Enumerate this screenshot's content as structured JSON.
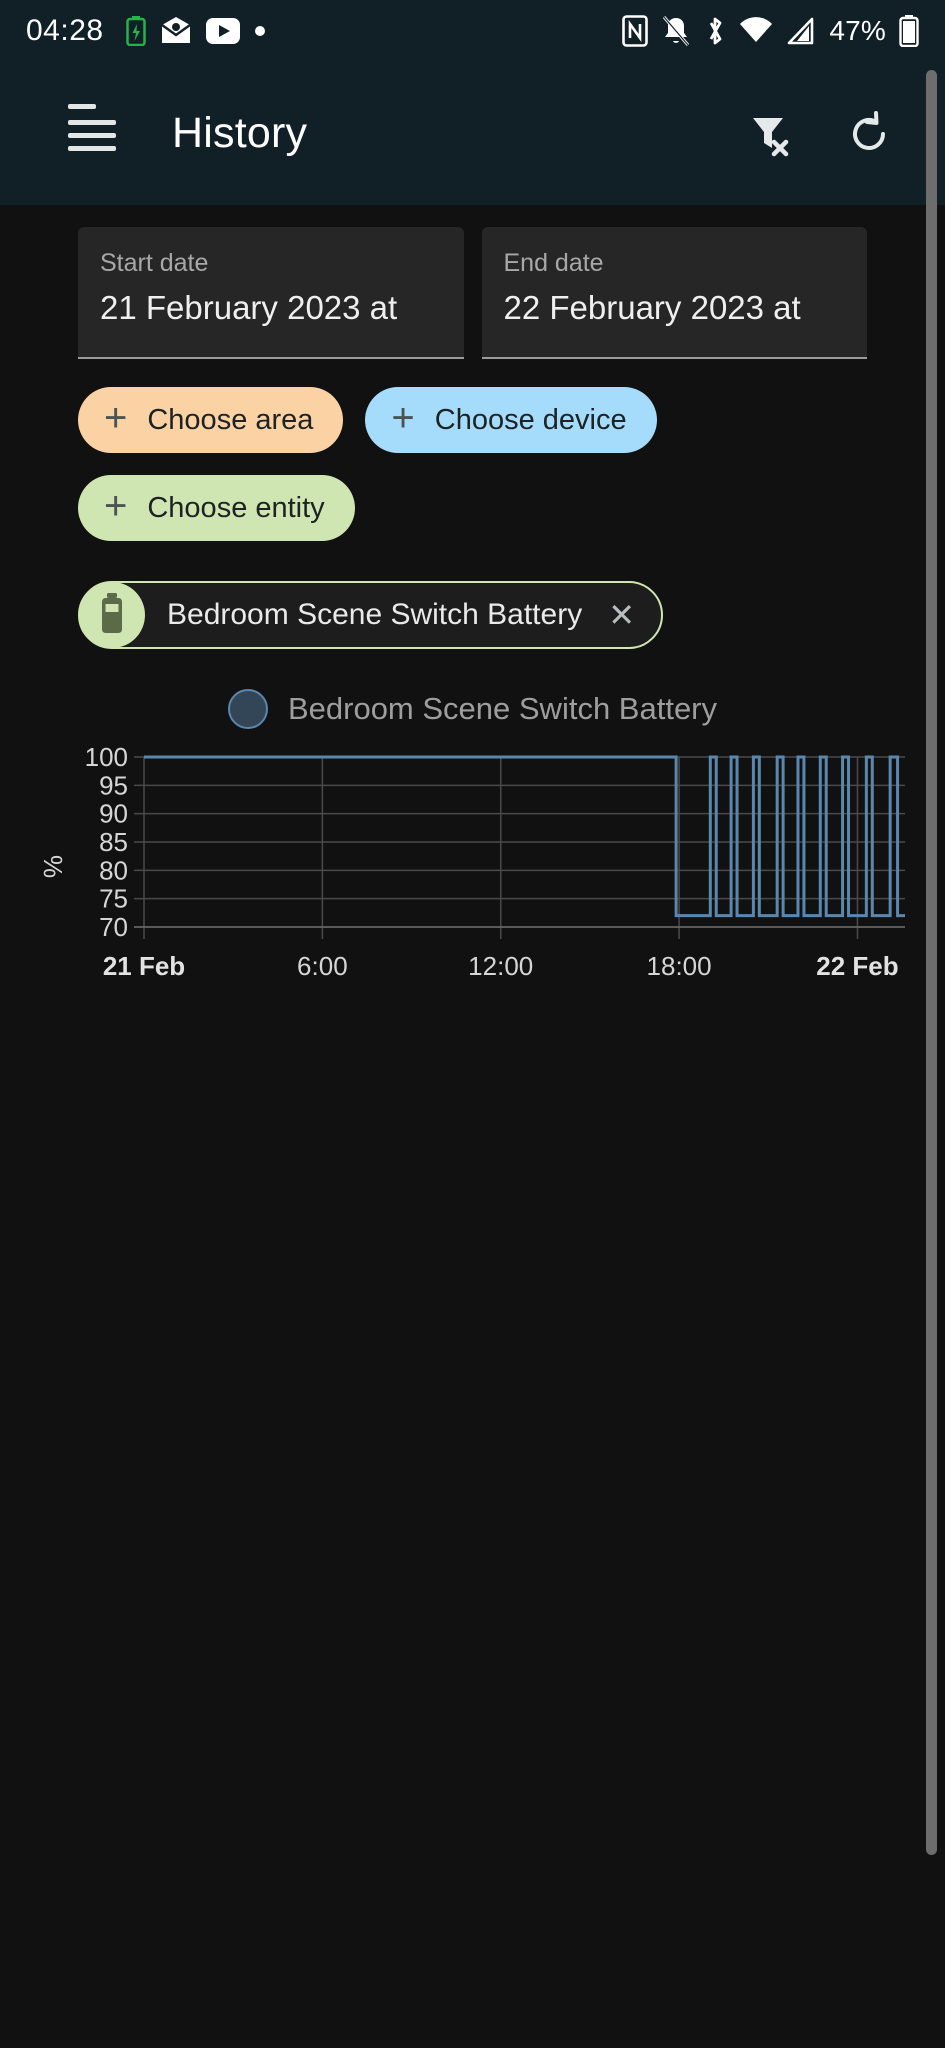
{
  "statusbar": {
    "time": "04:28",
    "battery_percent": "47%",
    "left_icons": [
      "battery-charging-icon",
      "mail-icon",
      "youtube-icon",
      "dot-icon"
    ],
    "right_icons": [
      "nfc-icon",
      "notifications-silenced-icon",
      "bluetooth-icon",
      "wifi-icon",
      "cellular-signal-icon"
    ],
    "accent": "#111f26"
  },
  "appbar": {
    "title": "History",
    "menu_icon": "hamburger-menu-icon",
    "badge_color": "#f5a623",
    "filter_icon": "filter-remove-icon",
    "refresh_icon": "refresh-icon",
    "background": "#111f26"
  },
  "filters": {
    "start": {
      "label": "Start date",
      "value": "21 February 2023 at"
    },
    "end": {
      "label": "End date",
      "value": "22 February 2023 at"
    },
    "chips": [
      {
        "label": "Choose area",
        "color": "#fbd2a4",
        "icon": "plus-icon"
      },
      {
        "label": "Choose device",
        "color": "#a6dcfb",
        "icon": "plus-icon"
      },
      {
        "label": "Choose entity",
        "color": "#cfe6b2",
        "icon": "plus-icon"
      }
    ],
    "selected_entity": {
      "label": "Bedroom Scene Switch Battery",
      "avatar_icon": "battery-icon",
      "avatar_color": "#cfe6b2",
      "remove_icon": "close-icon"
    }
  },
  "chart_data": {
    "type": "line",
    "title": "",
    "legend": [
      "Bedroom Scene Switch Battery"
    ],
    "legend_position": "top-center",
    "series_color": "#5a87ad",
    "xlabel": "",
    "ylabel": "%",
    "ylim": [
      70,
      100
    ],
    "yticks": [
      70,
      75,
      80,
      85,
      90,
      95,
      100
    ],
    "ytick_labels": [
      "70",
      "75",
      "80",
      "85",
      "90",
      "95",
      "100"
    ],
    "xticks": [
      0,
      6,
      12,
      18,
      24
    ],
    "xtick_labels": [
      "21 Feb",
      "6:00",
      "12:00",
      "18:00",
      "22 Feb"
    ],
    "xtick_bold": [
      true,
      false,
      false,
      false,
      true
    ],
    "xlim_hours": [
      0,
      25.6
    ],
    "grid": true,
    "step_interpolation": true,
    "series": [
      {
        "name": "Bedroom Scene Switch Battery",
        "unit": "%",
        "points": [
          {
            "t": 0.0,
            "v": 100
          },
          {
            "t": 17.9,
            "v": 100
          },
          {
            "t": 17.9,
            "v": 72
          },
          {
            "t": 19.05,
            "v": 72
          },
          {
            "t": 19.05,
            "v": 100
          },
          {
            "t": 19.25,
            "v": 100
          },
          {
            "t": 19.25,
            "v": 72
          },
          {
            "t": 19.75,
            "v": 72
          },
          {
            "t": 19.75,
            "v": 100
          },
          {
            "t": 19.95,
            "v": 100
          },
          {
            "t": 19.95,
            "v": 72
          },
          {
            "t": 20.5,
            "v": 72
          },
          {
            "t": 20.5,
            "v": 100
          },
          {
            "t": 20.7,
            "v": 100
          },
          {
            "t": 20.7,
            "v": 72
          },
          {
            "t": 21.3,
            "v": 72
          },
          {
            "t": 21.3,
            "v": 100
          },
          {
            "t": 21.5,
            "v": 100
          },
          {
            "t": 21.5,
            "v": 72
          },
          {
            "t": 22.0,
            "v": 72
          },
          {
            "t": 22.0,
            "v": 100
          },
          {
            "t": 22.2,
            "v": 100
          },
          {
            "t": 22.2,
            "v": 72
          },
          {
            "t": 22.75,
            "v": 72
          },
          {
            "t": 22.75,
            "v": 100
          },
          {
            "t": 22.95,
            "v": 100
          },
          {
            "t": 22.95,
            "v": 72
          },
          {
            "t": 23.5,
            "v": 72
          },
          {
            "t": 23.5,
            "v": 100
          },
          {
            "t": 23.7,
            "v": 100
          },
          {
            "t": 23.7,
            "v": 72
          },
          {
            "t": 24.3,
            "v": 72
          },
          {
            "t": 24.3,
            "v": 100
          },
          {
            "t": 24.5,
            "v": 100
          },
          {
            "t": 24.5,
            "v": 72
          },
          {
            "t": 25.1,
            "v": 72
          },
          {
            "t": 25.1,
            "v": 100
          },
          {
            "t": 25.35,
            "v": 100
          },
          {
            "t": 25.35,
            "v": 72
          },
          {
            "t": 25.6,
            "v": 72
          }
        ]
      }
    ]
  },
  "scrollbar": {
    "name": "vertical-scrollbar"
  }
}
